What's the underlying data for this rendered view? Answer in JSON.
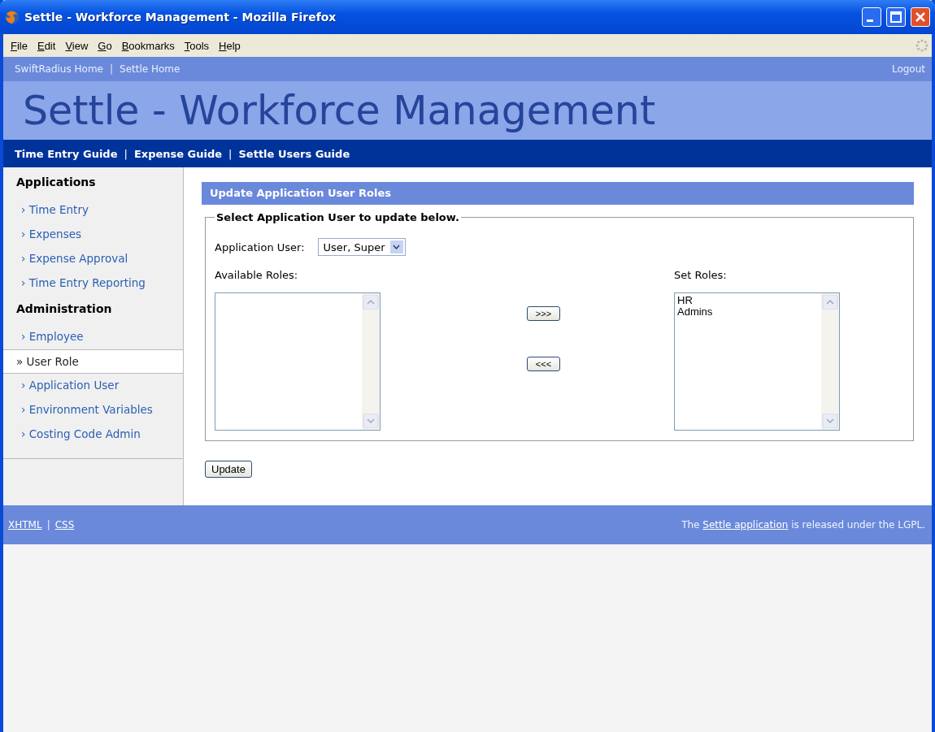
{
  "window": {
    "title": "Settle - Workforce Management - Mozilla Firefox"
  },
  "menu": [
    "File",
    "Edit",
    "View",
    "Go",
    "Bookmarks",
    "Tools",
    "Help"
  ],
  "top_nav": {
    "items": [
      {
        "kind": "link",
        "text": "SwiftRadius Home"
      },
      {
        "kind": "separator",
        "text": "|"
      },
      {
        "kind": "link",
        "text": "Settle Home"
      }
    ],
    "logout": "Logout"
  },
  "banner": {
    "title": "Settle - Workforce Management"
  },
  "guide_nav": {
    "items": [
      {
        "kind": "link",
        "text": "Time Entry Guide"
      },
      {
        "kind": "separator",
        "text": "|"
      },
      {
        "kind": "link",
        "text": "Expense Guide"
      },
      {
        "kind": "separator",
        "text": "|"
      },
      {
        "kind": "link",
        "text": "Settle Users Guide"
      }
    ]
  },
  "sidebar": {
    "sections": [
      {
        "heading": "Applications",
        "items": [
          {
            "label": "› Time Entry",
            "selected": false
          },
          {
            "label": "› Expenses",
            "selected": false
          },
          {
            "label": "› Expense Approval",
            "selected": false
          },
          {
            "label": "› Time Entry Reporting",
            "selected": false
          }
        ]
      },
      {
        "heading": "Administration",
        "items": [
          {
            "label": "› Employee",
            "selected": false
          },
          {
            "label": "» User Role",
            "selected": true
          },
          {
            "label": "› Application User",
            "selected": false
          },
          {
            "label": "› Environment Variables",
            "selected": false
          },
          {
            "label": "› Costing Code Admin",
            "selected": false
          }
        ]
      }
    ]
  },
  "panel": {
    "title": "Update Application User Roles",
    "legend": "Select Application User to update below.",
    "user_label": "Application User:",
    "user_value": "User, Super",
    "available_label": "Available Roles:",
    "set_label": "Set Roles:",
    "set_roles": [
      "HR",
      "Admins"
    ],
    "add_button": ">>>",
    "remove_button": "<<<",
    "update_button": "Update"
  },
  "footer": {
    "items": [
      {
        "kind": "link",
        "text": "XHTML"
      },
      {
        "kind": "separator",
        "text": "|"
      },
      {
        "kind": "link",
        "text": "CSS"
      }
    ],
    "license": {
      "before": "The ",
      "link": "Settle application",
      "after": " is released under the LGPL."
    }
  }
}
